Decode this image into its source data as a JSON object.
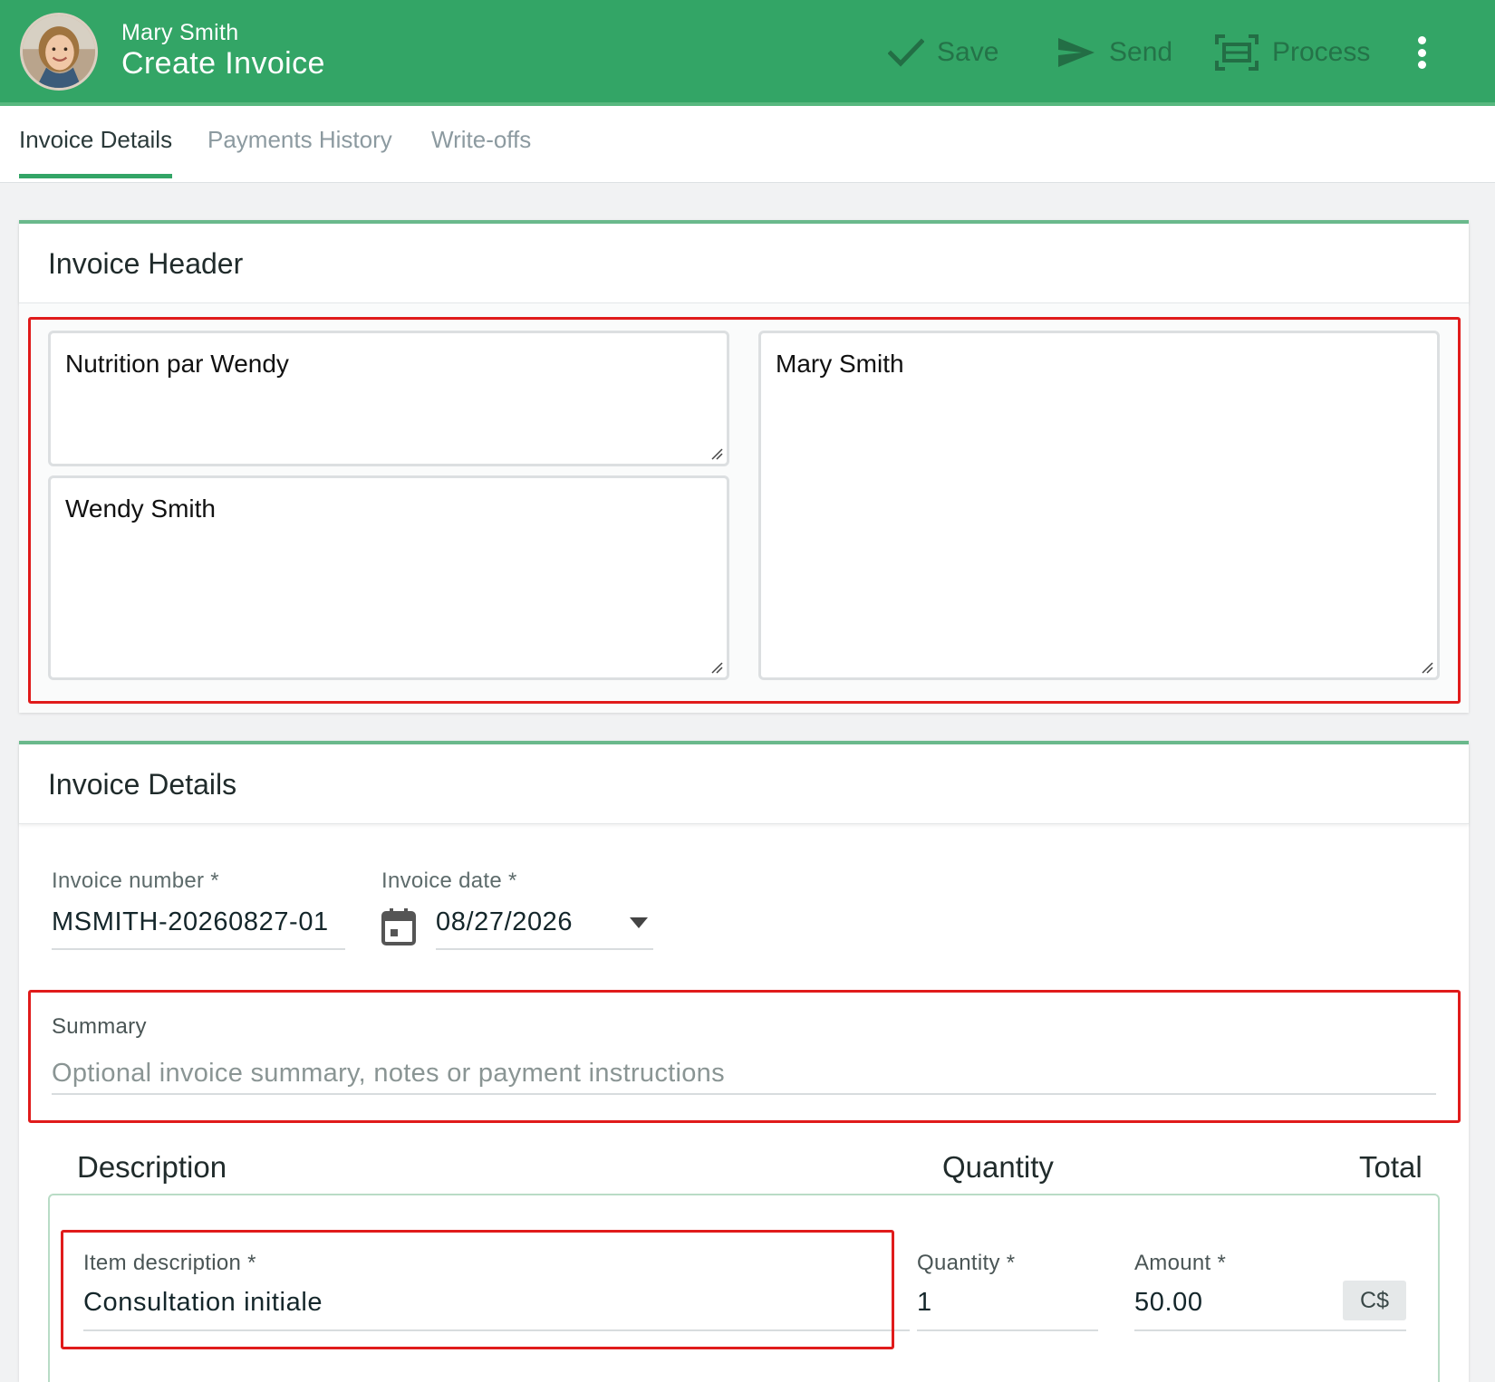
{
  "header": {
    "user_name": "Mary Smith",
    "title": "Create Invoice",
    "actions": {
      "save": "Save",
      "send": "Send",
      "process": "Process"
    }
  },
  "tabs": [
    {
      "label": "Invoice Details",
      "active": true
    },
    {
      "label": "Payments History",
      "active": false
    },
    {
      "label": "Write-offs",
      "active": false
    }
  ],
  "invoice_header": {
    "title": "Invoice Header",
    "business_name": "Nutrition par Wendy",
    "provider_name": "Wendy Smith",
    "client_name": "Mary Smith"
  },
  "invoice_details": {
    "title": "Invoice Details",
    "invoice_number_label": "Invoice number *",
    "invoice_number": "MSMITH-20260827-01",
    "invoice_date_label": "Invoice date *",
    "invoice_date": "08/27/2026",
    "summary_label": "Summary",
    "summary_placeholder": "Optional invoice summary, notes or payment instructions",
    "summary_value": ""
  },
  "line_items": {
    "columns": [
      "Description",
      "Quantity",
      "Total"
    ],
    "items": [
      {
        "description_label": "Item description *",
        "description": "Consultation initiale",
        "quantity_label": "Quantity *",
        "quantity": "1",
        "amount_label": "Amount *",
        "amount": "50.00",
        "currency": "C$"
      }
    ]
  },
  "colors": {
    "topbar": "#33a566",
    "accent": "#33a566",
    "highlight": "#e01b1b"
  }
}
